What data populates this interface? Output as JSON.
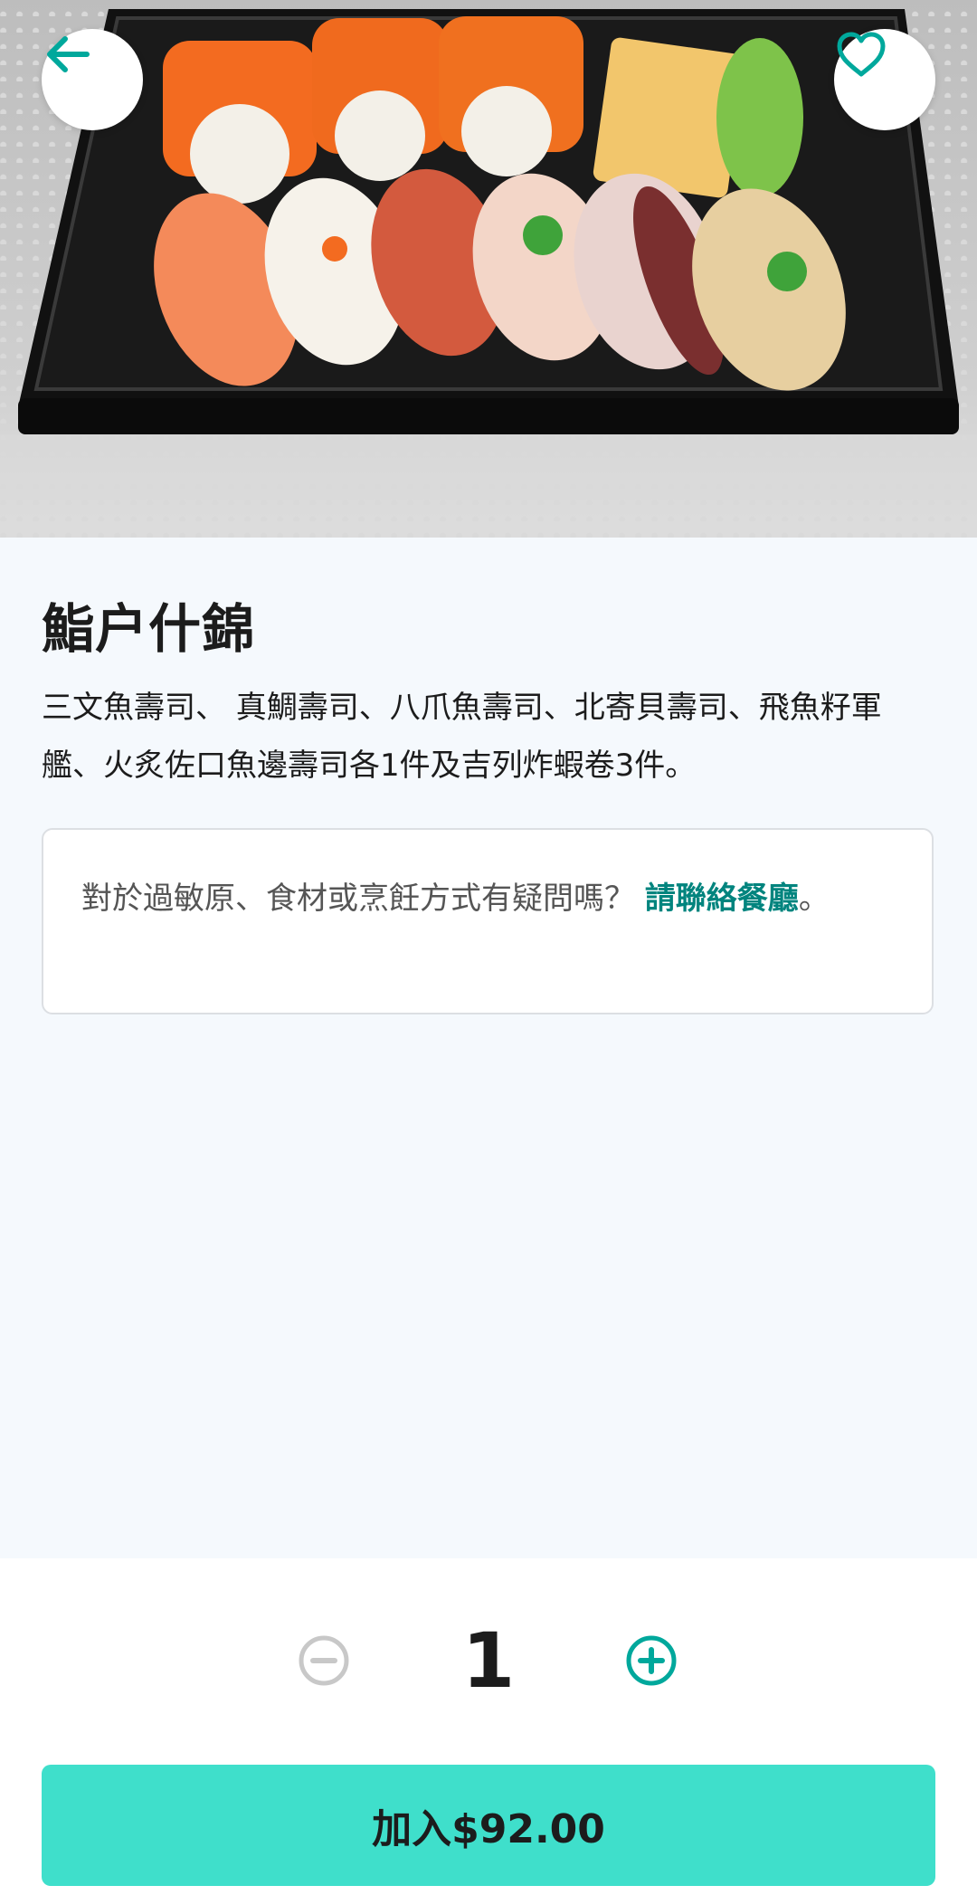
{
  "dish": {
    "title": "鮨户什錦",
    "description": "三文魚壽司、 真鯛壽司、八爪魚壽司、北寄貝壽司、飛魚籽軍艦、火炙佐口魚邊壽司各1件及吉列炸蝦卷3件。",
    "image_alt": "sushi-platter-photo"
  },
  "allergy": {
    "question": "對於過敏原、食材或烹飪方式有疑問嗎？",
    "link_text": "請聯絡餐廳",
    "suffix": "。"
  },
  "order": {
    "quantity": "1",
    "add_button": "加入$92.00"
  },
  "icons": {
    "back": "arrow-left-icon",
    "favorite": "heart-icon",
    "decrease": "minus-circle-icon",
    "increase": "plus-circle-icon"
  },
  "colors": {
    "accent": "#00a89c",
    "link": "#00847e",
    "button": "#3fdfcb",
    "disabled": "#c8c8c8"
  }
}
